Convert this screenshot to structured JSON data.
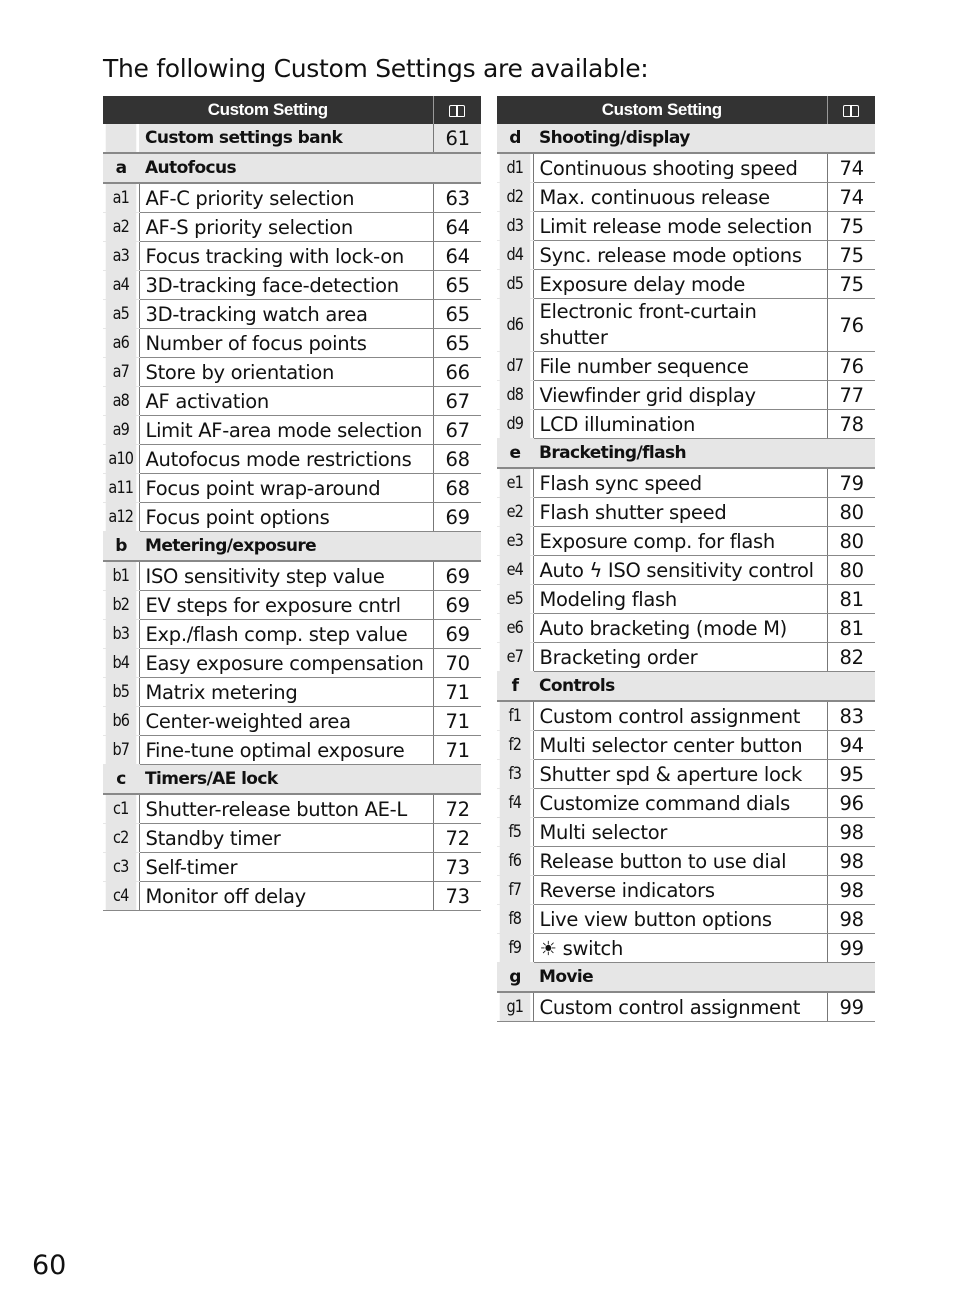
{
  "intro": "The following Custom Settings are available:",
  "header": {
    "setting_label": "Custom Setting",
    "page_icon": "book-icon"
  },
  "left": [
    {
      "type": "bank",
      "name": "Custom settings bank",
      "page": "61"
    },
    {
      "type": "group",
      "code": "a",
      "name": "Autofocus"
    },
    {
      "type": "row",
      "code": "a1",
      "name": "AF-C priority selection",
      "page": "63"
    },
    {
      "type": "row",
      "code": "a2",
      "name": "AF-S priority selection",
      "page": "64"
    },
    {
      "type": "row",
      "code": "a3",
      "name": "Focus tracking with lock-on",
      "page": "64"
    },
    {
      "type": "row",
      "code": "a4",
      "name": "3D-tracking face-detection",
      "page": "65"
    },
    {
      "type": "row",
      "code": "a5",
      "name": "3D-tracking watch area",
      "page": "65"
    },
    {
      "type": "row",
      "code": "a6",
      "name": "Number of focus points",
      "page": "65"
    },
    {
      "type": "row",
      "code": "a7",
      "name": "Store by orientation",
      "page": "66"
    },
    {
      "type": "row",
      "code": "a8",
      "name": "AF activation",
      "page": "67"
    },
    {
      "type": "row",
      "code": "a9",
      "name": "Limit AF-area mode selection",
      "page": "67"
    },
    {
      "type": "row",
      "code": "a10",
      "name": "Autofocus mode restrictions",
      "page": "68"
    },
    {
      "type": "row",
      "code": "a11",
      "name": "Focus point wrap-around",
      "page": "68"
    },
    {
      "type": "row",
      "code": "a12",
      "name": "Focus point options",
      "page": "69"
    },
    {
      "type": "group",
      "code": "b",
      "name": "Metering/exposure"
    },
    {
      "type": "row",
      "code": "b1",
      "name": "ISO sensitivity step value",
      "page": "69"
    },
    {
      "type": "row",
      "code": "b2",
      "name": "EV steps for exposure cntrl",
      "page": "69"
    },
    {
      "type": "row",
      "code": "b3",
      "name": "Exp./flash comp. step value",
      "page": "69"
    },
    {
      "type": "row",
      "code": "b4",
      "name": "Easy exposure compensation",
      "page": "70"
    },
    {
      "type": "row",
      "code": "b5",
      "name": "Matrix metering",
      "page": "71"
    },
    {
      "type": "row",
      "code": "b6",
      "name": "Center-weighted area",
      "page": "71"
    },
    {
      "type": "row",
      "code": "b7",
      "name": "Fine-tune optimal exposure",
      "page": "71"
    },
    {
      "type": "group",
      "code": "c",
      "name": "Timers/AE lock"
    },
    {
      "type": "row",
      "code": "c1",
      "name": "Shutter-release button AE-L",
      "page": "72"
    },
    {
      "type": "row",
      "code": "c2",
      "name": "Standby timer",
      "page": "72"
    },
    {
      "type": "row",
      "code": "c3",
      "name": "Self-timer",
      "page": "73"
    },
    {
      "type": "row",
      "code": "c4",
      "name": "Monitor off delay",
      "page": "73"
    }
  ],
  "right": [
    {
      "type": "group",
      "code": "d",
      "name": "Shooting/display"
    },
    {
      "type": "row",
      "code": "d1",
      "name": "Continuous shooting speed",
      "page": "74"
    },
    {
      "type": "row",
      "code": "d2",
      "name": "Max. continuous release",
      "page": "74"
    },
    {
      "type": "row",
      "code": "d3",
      "name": "Limit release mode selection",
      "page": "75"
    },
    {
      "type": "row",
      "code": "d4",
      "name": "Sync. release mode options",
      "page": "75"
    },
    {
      "type": "row",
      "code": "d5",
      "name": "Exposure delay mode",
      "page": "75"
    },
    {
      "type": "row",
      "code": "d6",
      "name": "Electronic front-curtain shutter",
      "page": "76",
      "tall": true
    },
    {
      "type": "row",
      "code": "d7",
      "name": "File number sequence",
      "page": "76"
    },
    {
      "type": "row",
      "code": "d8",
      "name": "Viewfinder grid display",
      "page": "77"
    },
    {
      "type": "row",
      "code": "d9",
      "name": "LCD illumination",
      "page": "78"
    },
    {
      "type": "group",
      "code": "e",
      "name": "Bracketing/flash"
    },
    {
      "type": "row",
      "code": "e1",
      "name": "Flash sync speed",
      "page": "79"
    },
    {
      "type": "row",
      "code": "e2",
      "name": "Flash shutter speed",
      "page": "80"
    },
    {
      "type": "row",
      "code": "e3",
      "name": "Exposure comp. for flash",
      "page": "80"
    },
    {
      "type": "row",
      "code": "e4",
      "name": "Auto ϟ ISO sensitivity control",
      "page": "80"
    },
    {
      "type": "row",
      "code": "e5",
      "name": "Modeling flash",
      "page": "81"
    },
    {
      "type": "row",
      "code": "e6",
      "name": "Auto bracketing (mode M)",
      "page": "81"
    },
    {
      "type": "row",
      "code": "e7",
      "name": "Bracketing order",
      "page": "82"
    },
    {
      "type": "group",
      "code": "f",
      "name": "Controls"
    },
    {
      "type": "row",
      "code": "f1",
      "name": "Custom control assignment",
      "page": "83"
    },
    {
      "type": "row",
      "code": "f2",
      "name": "Multi selector center button",
      "page": "94"
    },
    {
      "type": "row",
      "code": "f3",
      "name": "Shutter spd & aperture lock",
      "page": "95"
    },
    {
      "type": "row",
      "code": "f4",
      "name": "Customize command dials",
      "page": "96"
    },
    {
      "type": "row",
      "code": "f5",
      "name": "Multi selector",
      "page": "98"
    },
    {
      "type": "row",
      "code": "f6",
      "name": "Release button to use dial",
      "page": "98"
    },
    {
      "type": "row",
      "code": "f7",
      "name": "Reverse indicators",
      "page": "98"
    },
    {
      "type": "row",
      "code": "f8",
      "name": "Live view button options",
      "page": "98"
    },
    {
      "type": "row",
      "code": "f9",
      "name": "☀ switch",
      "page": "99"
    },
    {
      "type": "group",
      "code": "g",
      "name": "Movie"
    },
    {
      "type": "row",
      "code": "g1",
      "name": "Custom control assignment",
      "page": "99"
    }
  ],
  "page_number": "60"
}
